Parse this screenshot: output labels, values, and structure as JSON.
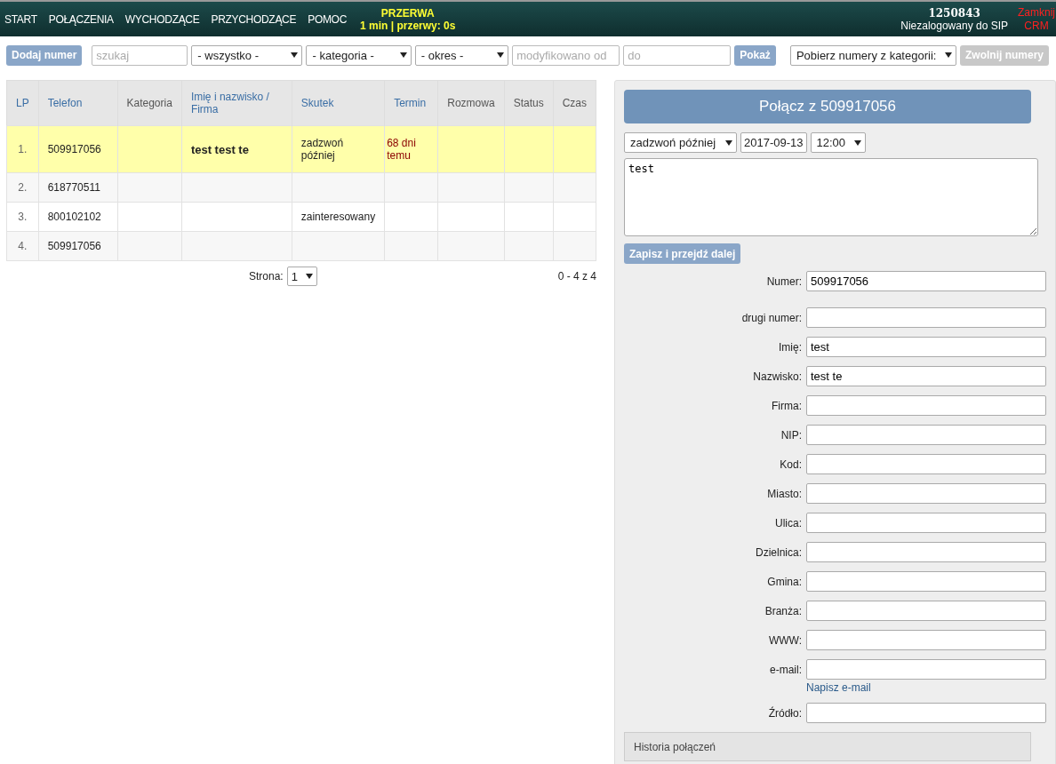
{
  "nav": {
    "items": [
      "START",
      "POŁĄCZENIA",
      "WYCHODZĄCE",
      "PRZYCHODZĄCE",
      "POMOC"
    ],
    "break": {
      "title": "PRZERWA",
      "info": "1 min | przerwy: 0s"
    },
    "user": {
      "id": "1250843",
      "sip": "Niezalogowany do SIP"
    },
    "close": "Zamknij CRM"
  },
  "toolbar": {
    "add": "Dodaj numer",
    "search": {
      "placeholder": "szukaj"
    },
    "selects": [
      "- wszystko -",
      "- kategoria -",
      "- okres -"
    ],
    "from": {
      "placeholder": "modyfikowano od"
    },
    "to": {
      "placeholder": "do"
    },
    "show": "Pokaż",
    "fetch": "Pobierz numery z kategorii:",
    "release": {
      "label": "Zwolnij numery",
      "disabled": true
    }
  },
  "table": {
    "columns": [
      {
        "label": "LP",
        "sortable": true
      },
      {
        "label": "Telefon",
        "sortable": true
      },
      {
        "label": "Kategoria",
        "sortable": false
      },
      {
        "label": "Imię i nazwisko / Firma",
        "sortable": true
      },
      {
        "label": "Skutek",
        "sortable": true
      },
      {
        "label": "Termin",
        "sortable": true
      },
      {
        "label": "Rozmowa",
        "sortable": false
      },
      {
        "label": "Status",
        "sortable": false
      },
      {
        "label": "Czas",
        "sortable": false
      }
    ],
    "rows": [
      {
        "selected": true,
        "cells": [
          "1.",
          "509917056",
          null,
          "test test te",
          "zadzwoń później",
          "68 dni temu",
          null,
          null,
          null
        ]
      },
      {
        "selected": false,
        "cells": [
          "2.",
          "618770511",
          null,
          null,
          null,
          null,
          null,
          null,
          null
        ]
      },
      {
        "selected": false,
        "cells": [
          "3.",
          "800102102",
          null,
          null,
          "zainteresowany",
          null,
          null,
          null,
          null
        ]
      },
      {
        "selected": false,
        "cells": [
          "4.",
          "509917056",
          null,
          null,
          null,
          null,
          null,
          null,
          null
        ]
      }
    ]
  },
  "pager": {
    "label": "Strona:",
    "page": "1",
    "count": "0 - 4 z 4"
  },
  "panel": {
    "call": "Połącz z 509917056",
    "result": "zadzwoń później",
    "date": "2017-09-13",
    "time": "12:00",
    "note": "test",
    "save": "Zapisz i przejdź dalej",
    "fields": [
      {
        "label": "Numer:",
        "value": "509917056"
      },
      {
        "label": "drugi numer:"
      },
      {
        "label": "Imię:",
        "value": "test"
      },
      {
        "label": "Nazwisko:",
        "value": "test te"
      },
      {
        "label": "Firma:"
      },
      {
        "label": "NIP:"
      },
      {
        "label": "Kod:"
      },
      {
        "label": "Miasto:"
      },
      {
        "label": "Ulica:"
      },
      {
        "label": "Dzielnica:"
      },
      {
        "label": "Gmina:"
      },
      {
        "label": "Branża:"
      },
      {
        "label": "WWW:"
      },
      {
        "label": "e-mail:",
        "link": "Napisz e-mail"
      },
      {
        "label": "Źródło:"
      }
    ],
    "history": "Historia połączeń"
  }
}
